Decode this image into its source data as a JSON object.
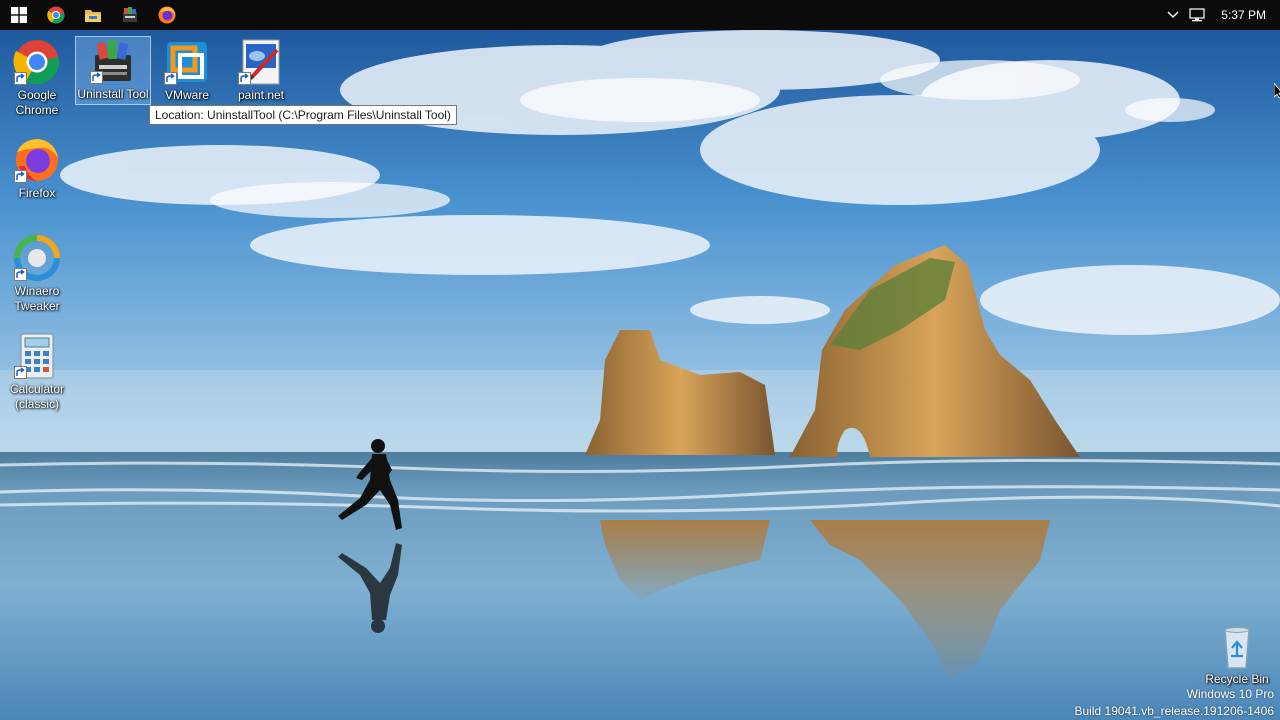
{
  "taskbar": {
    "buttons": [
      {
        "name": "start-button",
        "icon": "windows-logo-icon"
      },
      {
        "name": "taskbar-chrome",
        "icon": "chrome-icon"
      },
      {
        "name": "taskbar-file-explorer",
        "icon": "folder-icon"
      },
      {
        "name": "taskbar-uninstall-tool",
        "icon": "uninstall-tool-icon"
      },
      {
        "name": "taskbar-firefox",
        "icon": "firefox-icon"
      }
    ],
    "tray": {
      "chevron_icon": "chevron-up-icon",
      "network_icon": "network-icon",
      "time": "5:37 PM"
    }
  },
  "desktop": {
    "icons": [
      {
        "label": "Google Chrome",
        "icon": "chrome-icon",
        "selected": false
      },
      {
        "label": "Uninstall Tool",
        "icon": "uninstall-tool-icon",
        "selected": true
      },
      {
        "label": "VMware",
        "icon": "vmware-icon",
        "selected": false
      },
      {
        "label": "paint.net",
        "icon": "paintnet-icon",
        "selected": false
      },
      {
        "label": "Firefox",
        "icon": "firefox-icon",
        "selected": false
      },
      {
        "label": "Winaero Tweaker",
        "icon": "winaero-tweaker-icon",
        "selected": false
      },
      {
        "label": "Calculator (classic)",
        "icon": "calculator-icon",
        "selected": false
      },
      {
        "label": "Recycle Bin",
        "icon": "recycle-bin-icon",
        "selected": false
      }
    ],
    "tooltip": "Location: UninstallTool (C:\\Program Files\\Uninstall Tool)"
  },
  "watermark": {
    "edition": "Windows 10 Pro",
    "build": "Build 19041.vb_release.191206-1406"
  },
  "colors": {
    "taskbar": "#0b0b0b",
    "sky": "#3a86c9",
    "sea": "#5d8fb0"
  }
}
